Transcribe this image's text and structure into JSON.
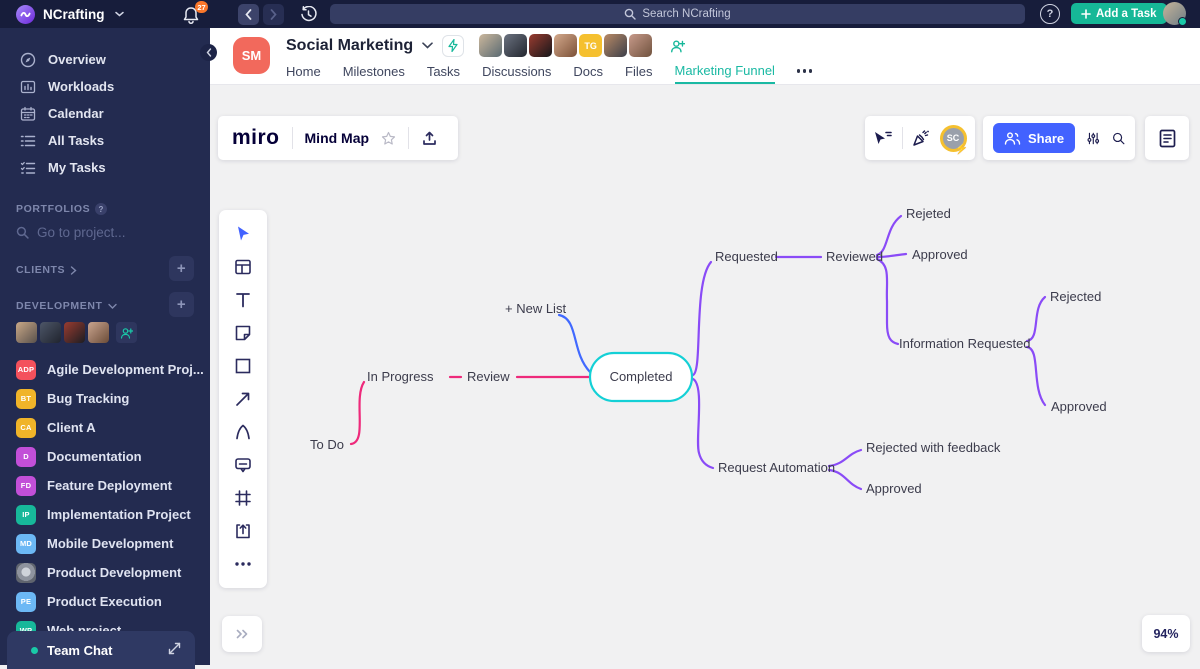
{
  "colors": {
    "accent_teal": "#16b897",
    "tab_active": "#1ab9a3",
    "miro_blue": "#4262ff",
    "mindmap_pink": "#ee2a7b",
    "mindmap_purple": "#8a4bf7",
    "mindmap_blue": "#4169ff",
    "mindmap_cyan": "#14d0d6"
  },
  "topbar": {
    "app_name": "NCrafting",
    "notifications_count": "27",
    "search_placeholder": "Search NCrafting",
    "help_label": "?",
    "add_task_label": "Add a Task"
  },
  "sidebar": {
    "nav": [
      {
        "label": "Overview"
      },
      {
        "label": "Workloads"
      },
      {
        "label": "Calendar"
      },
      {
        "label": "All Tasks"
      },
      {
        "label": "My Tasks"
      }
    ],
    "portfolios_label": "PORTFOLIOS",
    "project_search_placeholder": "Go to project...",
    "clients_label": "CLIENTS",
    "development_label": "DEVELOPMENT",
    "projects": [
      {
        "abbr": "ADP",
        "label": "Agile Development Proj...",
        "color": "#f4515c"
      },
      {
        "abbr": "BT",
        "label": "Bug Tracking",
        "color": "#f0b429"
      },
      {
        "abbr": "CA",
        "label": "Client A",
        "color": "#f0b429"
      },
      {
        "abbr": "D",
        "label": "Documentation",
        "color": "#c24fd8"
      },
      {
        "abbr": "FD",
        "label": "Feature Deployment",
        "color": "#c24fd8"
      },
      {
        "abbr": "IP",
        "label": "Implementation Project",
        "color": "#17b89a"
      },
      {
        "abbr": "MD",
        "label": "Mobile Development",
        "color": "#6cb8f5"
      },
      {
        "abbr": "",
        "label": "Product Development",
        "color": ""
      },
      {
        "abbr": "PE",
        "label": "Product Execution",
        "color": "#6cb8f5"
      },
      {
        "abbr": "WP",
        "label": "Web project",
        "color": "#17b89a"
      }
    ],
    "team_chat_label": "Team Chat"
  },
  "project_header": {
    "avatar_initials": "SM",
    "title": "Social Marketing",
    "team_badge": "TG",
    "tabs": [
      "Home",
      "Milestones",
      "Tasks",
      "Discussions",
      "Docs",
      "Files",
      "Marketing Funnel"
    ],
    "active_tab": "Marketing Funnel"
  },
  "miro": {
    "logo": "miro",
    "board_title": "Mind Map",
    "share_label": "Share",
    "collaborator_initials": "SC",
    "zoom_level": "94%"
  },
  "chart_data": {
    "type": "mindmap",
    "root": "Completed",
    "edges": [
      [
        "To Do",
        "In Progress"
      ],
      [
        "In Progress",
        "Review"
      ],
      [
        "Review",
        "Completed"
      ],
      [
        "+ New List",
        "Completed"
      ],
      [
        "Completed",
        "Requested"
      ],
      [
        "Requested",
        "Reviewed"
      ],
      [
        "Reviewed",
        "Rejeted"
      ],
      [
        "Reviewed",
        "Approved"
      ],
      [
        "Reviewed",
        "Information Requested"
      ],
      [
        "Information Requested",
        "Rejected"
      ],
      [
        "Information Requested",
        "Approved"
      ],
      [
        "Completed",
        "Request Automation"
      ],
      [
        "Request Automation",
        "Rejected with feedback"
      ],
      [
        "Request Automation",
        "Approved"
      ]
    ]
  },
  "mindmap": {
    "todo": "To Do",
    "in_progress": "In Progress",
    "review": "Review",
    "completed": "Completed",
    "new_list": "+ New List",
    "requested": "Requested",
    "reviewed": "Reviewed",
    "rejeted": "Rejeted",
    "approved_1": "Approved",
    "information_requested": "Information Requested",
    "rejected_2": "Rejected",
    "approved_2": "Approved",
    "request_automation": "Request Automation",
    "rejected_feedback": "Rejected with feedback",
    "approved_3": "Approved"
  }
}
